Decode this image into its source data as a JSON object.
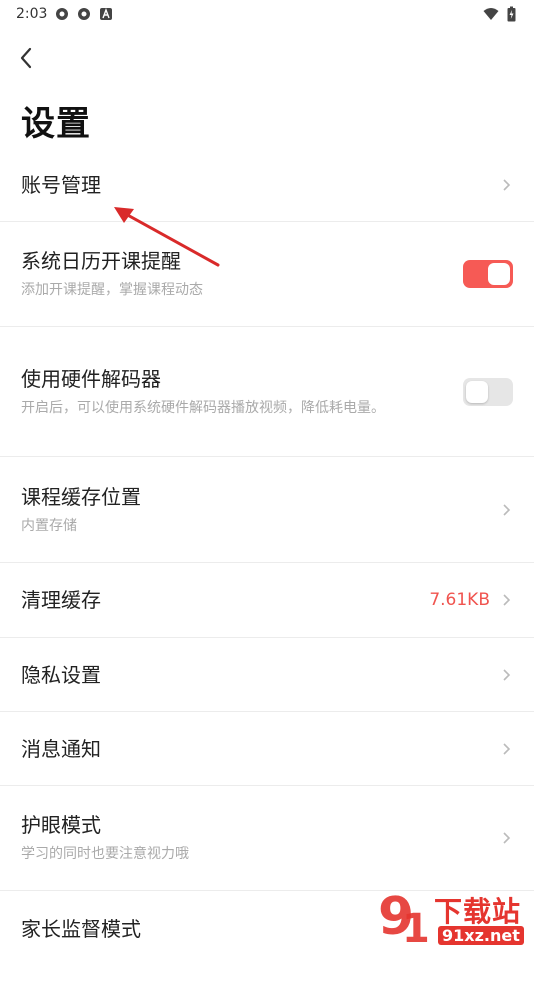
{
  "status_bar": {
    "time": "2:03"
  },
  "page": {
    "title": "设置"
  },
  "items": [
    {
      "label": "账号管理"
    },
    {
      "label": "系统日历开课提醒",
      "sub": "添加开课提醒，掌握课程动态",
      "toggle": true
    },
    {
      "label": "使用硬件解码器",
      "sub": "开启后，可以使用系统硬件解码器播放视频，降低耗电量。",
      "toggle": false
    },
    {
      "label": "课程缓存位置",
      "sub": "内置存储"
    },
    {
      "label": "清理缓存",
      "value": "7.61KB"
    },
    {
      "label": "隐私设置"
    },
    {
      "label": "消息通知"
    },
    {
      "label": "护眼模式",
      "sub": "学习的同时也要注意视力哦"
    },
    {
      "label": "家长监督模式"
    }
  ],
  "watermark": {
    "text": "下载站",
    "url_text": "91xz.net"
  },
  "colors": {
    "accent": "#f65a55",
    "value": "#f0544f",
    "arrow": "#d92a2a"
  }
}
